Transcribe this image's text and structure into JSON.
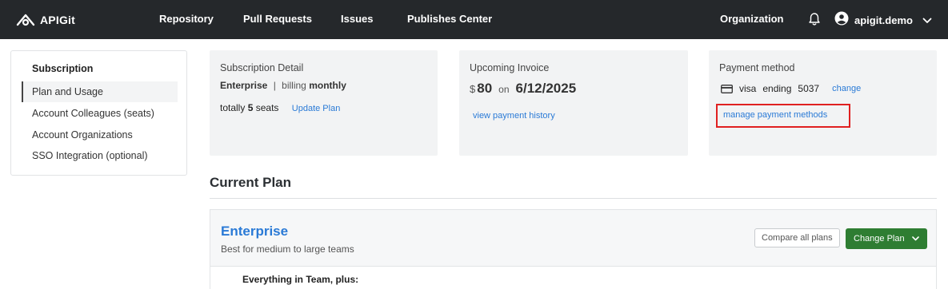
{
  "app": {
    "name": "APIGit",
    "logo_icon": "apigit-logo-icon"
  },
  "nav": {
    "items": [
      "Repository",
      "Pull Requests",
      "Issues",
      "Publishes Center"
    ],
    "organization": "Organization",
    "bell_icon": "bell-icon",
    "user_icon": "account-circle-icon",
    "username": "apigit.demo",
    "dropdown_icon": "chevron-down-icon"
  },
  "sidebar": {
    "title": "Subscription",
    "items": [
      {
        "label": "Plan and Usage",
        "active": true
      },
      {
        "label": "Account Colleagues (seats)",
        "active": false
      },
      {
        "label": "Account Organizations",
        "active": false
      },
      {
        "label": "SSO Integration (optional)",
        "active": false
      }
    ]
  },
  "subscription_detail": {
    "title": "Subscription Detail",
    "plan": "Enterprise",
    "separator": "|",
    "billing_label": "billing",
    "billing_period": "monthly",
    "seats_prefix": "totally",
    "seats_count": "5",
    "seats_suffix": "seats",
    "update_plan_link": "Update Plan"
  },
  "upcoming_invoice": {
    "title": "Upcoming Invoice",
    "currency": "$",
    "amount": "80",
    "on_label": "on",
    "date": "6/12/2025",
    "history_link": "view payment history"
  },
  "payment_method": {
    "title": "Payment method",
    "card_icon": "credit-card-icon",
    "brand": "visa",
    "ending_label": "ending",
    "last4": "5037",
    "change_link": "change",
    "manage_link": "manage payment methods"
  },
  "current_plan": {
    "section_title": "Current Plan",
    "name": "Enterprise",
    "description": "Best for medium to large teams",
    "compare_button": "Compare all plans",
    "change_button": "Change Plan",
    "feature_heading": "Everything in Team, plus:"
  },
  "colors": {
    "topbar": "#25282b",
    "link": "#2a7ad6",
    "primary_button": "#2e7d32",
    "highlight_border": "#e02020"
  }
}
